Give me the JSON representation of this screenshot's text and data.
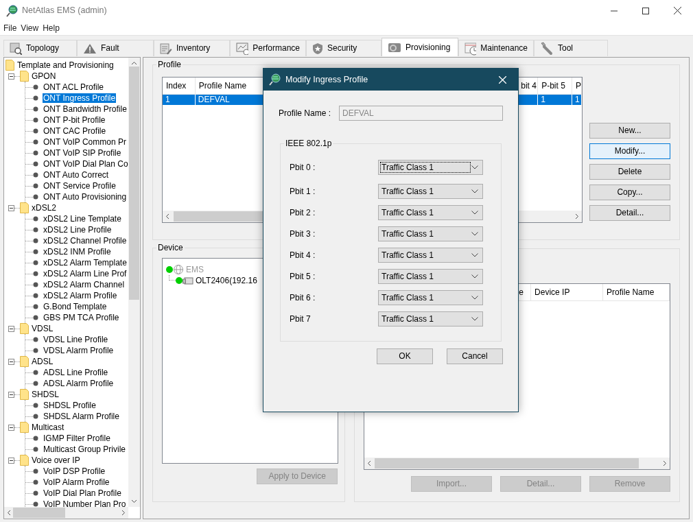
{
  "window": {
    "title": "NetAtlas EMS (admin)"
  },
  "menu": [
    "File",
    "View",
    "Help"
  ],
  "tabs": [
    {
      "label": "Topology",
      "selected": false
    },
    {
      "label": "Fault",
      "selected": false
    },
    {
      "label": "Inventory",
      "selected": false
    },
    {
      "label": "Performance",
      "selected": false
    },
    {
      "label": "Security",
      "selected": false
    },
    {
      "label": "Provisioning",
      "selected": true
    },
    {
      "label": "Maintenance",
      "selected": false
    },
    {
      "label": "Tool",
      "selected": false
    }
  ],
  "tree": {
    "label": "Template and Provisioning",
    "children": [
      {
        "label": "GPON",
        "expanded": true,
        "children": [
          {
            "label": "ONT ACL Profile",
            "selected": false
          },
          {
            "label": "ONT Ingress Profile",
            "selected": true
          },
          {
            "label": "ONT Bandwidth Profile",
            "selected": false
          },
          {
            "label": "ONT P-bit Profile",
            "selected": false
          },
          {
            "label": "ONT CAC Profile",
            "selected": false
          },
          {
            "label": "ONT VoIP Common Pr",
            "selected": false
          },
          {
            "label": "ONT VoIP SIP Profile",
            "selected": false
          },
          {
            "label": "ONT VoIP Dial Plan Co",
            "selected": false
          },
          {
            "label": "ONT Auto Correct",
            "selected": false
          },
          {
            "label": "ONT Service Profile",
            "selected": false
          },
          {
            "label": "ONT Auto Provisioning",
            "selected": false
          }
        ]
      },
      {
        "label": "xDSL2",
        "expanded": true,
        "children": [
          {
            "label": "xDSL2 Line Template",
            "selected": false
          },
          {
            "label": "xDSL2 Line Profile",
            "selected": false
          },
          {
            "label": "xDSL2 Channel Profile",
            "selected": false
          },
          {
            "label": "xDSL2 INM Profile",
            "selected": false
          },
          {
            "label": "xDSL2 Alarm Template",
            "selected": false
          },
          {
            "label": "xDSL2 Alarm Line Prof",
            "selected": false
          },
          {
            "label": "xDSL2 Alarm Channel",
            "selected": false
          },
          {
            "label": "xDSL2 Alarm Profile",
            "selected": false
          },
          {
            "label": "G.Bond Template",
            "selected": false
          },
          {
            "label": "GBS PM TCA Profile",
            "selected": false
          }
        ]
      },
      {
        "label": "VDSL",
        "expanded": true,
        "children": [
          {
            "label": "VDSL Line Profile",
            "selected": false
          },
          {
            "label": "VDSL Alarm Profile",
            "selected": false
          }
        ]
      },
      {
        "label": "ADSL",
        "expanded": true,
        "children": [
          {
            "label": "ADSL Line Profile",
            "selected": false
          },
          {
            "label": "ADSL Alarm Profile",
            "selected": false
          }
        ]
      },
      {
        "label": "SHDSL",
        "expanded": true,
        "children": [
          {
            "label": "SHDSL Profile",
            "selected": false
          },
          {
            "label": "SHDSL Alarm Profile",
            "selected": false
          }
        ]
      },
      {
        "label": "Multicast",
        "expanded": true,
        "children": [
          {
            "label": "IGMP Filter Profile",
            "selected": false
          },
          {
            "label": "Multicast Group Privile",
            "selected": false
          }
        ]
      },
      {
        "label": "Voice over IP",
        "expanded": true,
        "children": [
          {
            "label": "VoIP DSP Profile",
            "selected": false
          },
          {
            "label": "VoIP Alarm Profile",
            "selected": false
          },
          {
            "label": "VoIP Dial Plan Profile",
            "selected": false
          },
          {
            "label": "VoIP Number Plan Pro",
            "selected": false
          }
        ]
      }
    ]
  },
  "profile_panel": {
    "title": "Profile",
    "table": {
      "columns": [
        "Index",
        "Profile Name",
        "bit 4",
        "P-bit 5",
        "P"
      ],
      "rows": [
        {
          "selected": true,
          "left_cells": [
            "1",
            "DEFVAL"
          ],
          "right_cells": [
            "1",
            "1"
          ]
        }
      ]
    },
    "buttons": [
      {
        "label": "New...",
        "highlighted": false
      },
      {
        "label": "Modify...",
        "highlighted": true
      },
      {
        "label": "Delete",
        "highlighted": false
      },
      {
        "label": "Copy...",
        "highlighted": false
      },
      {
        "label": "Detail...",
        "highlighted": false
      }
    ]
  },
  "device_panel": {
    "title": "Device",
    "tree": [
      {
        "label": "EMS",
        "dimmed": true,
        "children": [
          {
            "label": "OLT2406(192.16",
            "dimmed": false
          }
        ]
      }
    ],
    "buttons": [
      {
        "label": "Apply to Device",
        "disabled": true
      }
    ]
  },
  "target_panel": {
    "table": {
      "columns": [
        "e",
        "Device IP",
        "Profile Name"
      ]
    },
    "buttons": [
      {
        "label": "Import...",
        "disabled": true
      },
      {
        "label": "Detail...",
        "disabled": true
      },
      {
        "label": "Remove",
        "disabled": true
      }
    ]
  },
  "dialog": {
    "title": "Modify Ingress Profile",
    "profile_name": {
      "label": "Profile Name :",
      "value": "DEFVAL",
      "disabled": true
    },
    "group": {
      "title": "IEEE 802.1p",
      "rows": [
        {
          "label": "Pbit 0 :",
          "value": "Traffic Class 1",
          "focused": true
        },
        {
          "label": "Pbit 1 :",
          "value": "Traffic Class 1",
          "focused": false
        },
        {
          "label": "Pbit 2 :",
          "value": "Traffic Class 1",
          "focused": false
        },
        {
          "label": "Pbit 3 :",
          "value": "Traffic Class 1",
          "focused": false
        },
        {
          "label": "Pbit 4 :",
          "value": "Traffic Class 1",
          "focused": false
        },
        {
          "label": "Pbit 5 :",
          "value": "Traffic Class 1",
          "focused": false
        },
        {
          "label": "Pbit 6 :",
          "value": "Traffic Class 1",
          "focused": false
        },
        {
          "label": "Pbit 7",
          "value": "Traffic Class 1",
          "focused": false
        }
      ]
    },
    "buttons": [
      "OK",
      "Cancel"
    ]
  }
}
